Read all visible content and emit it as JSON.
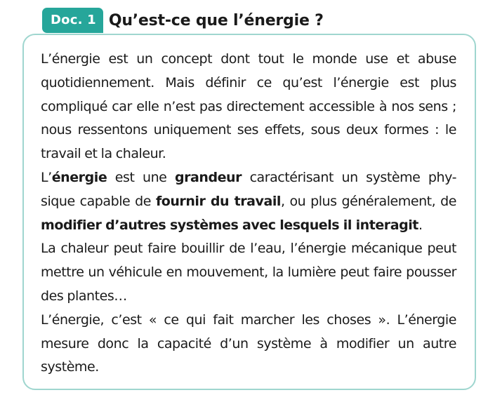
{
  "header": {
    "badge": "Doc. 1",
    "title": "Qu’est-ce que l’énergie ?"
  },
  "body": {
    "p1": "L’énergie est un concept dont tout le monde use et abuse quotidiennement. Mais définir ce qu’est l’énergie est plus compliqué car elle n’est pas directement accessible à nos sens ; nous ressentons uniquement ses effets, sous deux formes : le travail et la chaleur.",
    "p2": {
      "s1": "L’",
      "b1": "énergie",
      "s2": " est une ",
      "b2": "grandeur",
      "s3": " caractérisant un système phy-sique capable de ",
      "b3": "fournir du travail",
      "s4": ", ou plus généralement, de ",
      "b4": "modifier d’autres systèmes avec lesquels il interagit",
      "s5": "."
    },
    "p3": "La chaleur peut faire bouillir de l’eau, l’énergie mécanique peut mettre un véhicule en mouvement, la lumière peut faire pousser des plantes…",
    "p4": "L’énergie, c’est « ce qui fait marcher les choses ». L’énergie mesure donc la capacité d’un système à modifier un autre système."
  },
  "colors": {
    "accent": "#26a69a",
    "border": "#9fd6cf",
    "text": "#1a1a1a"
  }
}
